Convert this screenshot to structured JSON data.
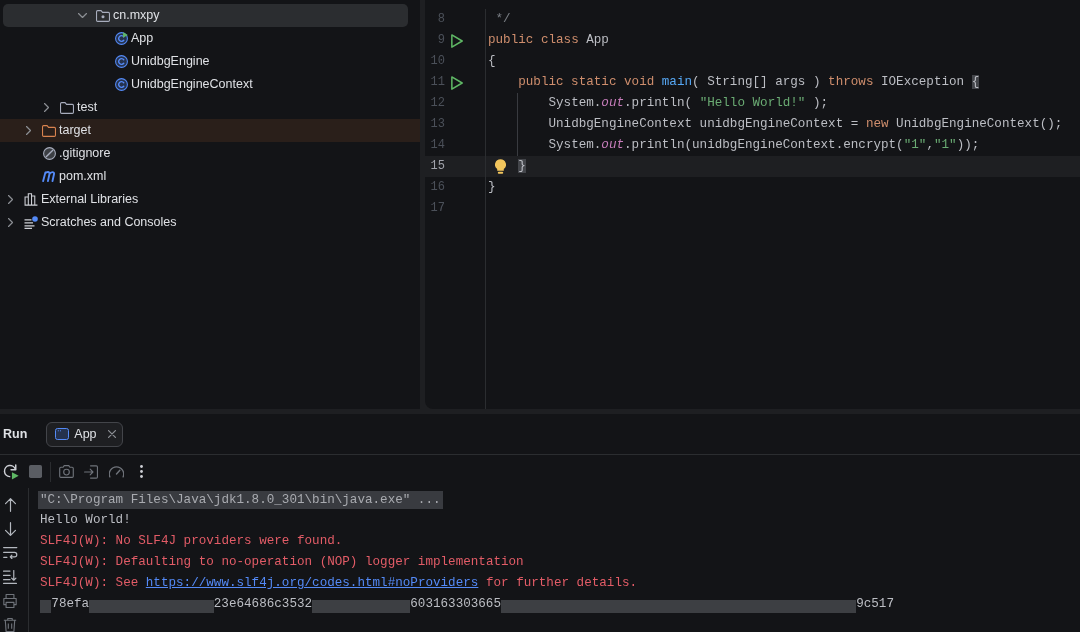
{
  "project_tree": {
    "items": [
      {
        "children": [
          {
            "children": [
              {
                "children": [
                  {
                    "children": [
                      {
                        "label": "cn.mxpy",
                        "kind": "package",
                        "expanded": true,
                        "selected": true,
                        "children": [
                          {
                            "label": "App",
                            "kind": "runnable-class",
                            "selected": false
                          },
                          {
                            "label": "UnidbgEngine",
                            "kind": "class",
                            "selected": false
                          },
                          {
                            "label": "UnidbgEngineContext",
                            "kind": "class",
                            "selected": false
                          }
                        ]
                      }
                    ]
                  }
                ]
              },
              {
                "label": "test",
                "kind": "folder",
                "expanded": false,
                "selected": false
              }
            ]
          },
          {
            "label": "target",
            "kind": "excluded-folder",
            "expanded": false,
            "selected": false
          },
          {
            "label": ".gitignore",
            "kind": "ignore-file",
            "selected": false
          },
          {
            "label": "pom.xml",
            "kind": "maven-file",
            "selected": false
          }
        ]
      },
      {
        "label": "External Libraries",
        "kind": "libraries",
        "expanded": false,
        "selected": false
      },
      {
        "label": "Scratches and Consoles",
        "kind": "scratches",
        "expanded": false,
        "selected": false
      }
    ]
  },
  "editor": {
    "lines": [
      {
        "number": "8",
        "kind": "comment",
        "current": false,
        "run": false,
        "bulb": false,
        "tokens": [
          {
            "kind": "comment",
            "text": "*/"
          }
        ]
      },
      {
        "number": "9",
        "kind": "top-level",
        "current": false,
        "run": true,
        "bulb": false,
        "tokens": [
          {
            "kind": "keyword",
            "text": "public class "
          },
          {
            "kind": "plain",
            "text": "App"
          }
        ]
      },
      {
        "number": "10",
        "kind": "top-level",
        "current": false,
        "run": false,
        "bulb": false,
        "tokens": [
          {
            "kind": "plain",
            "text": "{"
          }
        ]
      },
      {
        "number": "11",
        "kind": "class-body",
        "current": false,
        "run": true,
        "bulb": false,
        "tokens": [
          {
            "kind": "keyword",
            "text": "public static void "
          },
          {
            "kind": "method",
            "text": "main"
          },
          {
            "kind": "plain",
            "text": "( String[] args ) "
          },
          {
            "kind": "keyword",
            "text": "throws "
          },
          {
            "kind": "plain",
            "text": "IOException "
          },
          {
            "kind": "brace-match",
            "text": "{"
          }
        ]
      },
      {
        "number": "12",
        "kind": "method-body",
        "current": false,
        "run": false,
        "bulb": false,
        "tokens": [
          {
            "kind": "plain",
            "text": "System."
          },
          {
            "kind": "field",
            "text": "out"
          },
          {
            "kind": "plain",
            "text": ".println( "
          },
          {
            "kind": "string",
            "text": "\"Hello World!\""
          },
          {
            "kind": "plain",
            "text": " );"
          }
        ]
      },
      {
        "number": "13",
        "kind": "method-body",
        "current": false,
        "run": false,
        "bulb": false,
        "tokens": [
          {
            "kind": "plain",
            "text": "UnidbgEngineContext unidbgEngineContext = "
          },
          {
            "kind": "keyword",
            "text": "new "
          },
          {
            "kind": "plain",
            "text": "UnidbgEngineContext();"
          }
        ]
      },
      {
        "number": "14",
        "kind": "method-body",
        "current": false,
        "run": false,
        "bulb": false,
        "tokens": [
          {
            "kind": "plain",
            "text": "System."
          },
          {
            "kind": "field",
            "text": "out"
          },
          {
            "kind": "plain",
            "text": ".println(unidbgEngineContext.encrypt("
          },
          {
            "kind": "string",
            "text": "\"1\""
          },
          {
            "kind": "plain",
            "text": ","
          },
          {
            "kind": "string",
            "text": "\"1\""
          },
          {
            "kind": "plain",
            "text": "));"
          }
        ]
      },
      {
        "number": "15",
        "kind": "class-body",
        "current": true,
        "run": false,
        "bulb": true,
        "tokens": [
          {
            "kind": "brace-match",
            "text": "}"
          }
        ]
      },
      {
        "number": "16",
        "kind": "top-level",
        "current": false,
        "run": false,
        "bulb": false,
        "tokens": [
          {
            "kind": "plain",
            "text": "}"
          }
        ]
      },
      {
        "number": "17",
        "kind": "top-level",
        "current": false,
        "run": false,
        "bulb": false
      }
    ]
  },
  "run_panel": {
    "title": "Run",
    "tabs": [
      {
        "label": "App",
        "selected": true
      }
    ],
    "toolbar": [
      {
        "kind": "rerun",
        "disabled": false
      },
      {
        "kind": "stop",
        "disabled": true
      },
      {
        "kind": "screenshot",
        "disabled": true
      },
      {
        "kind": "attach",
        "disabled": true
      },
      {
        "kind": "profiler",
        "disabled": true
      },
      {
        "kind": "more",
        "disabled": false
      }
    ],
    "console": [
      {
        "kind": "command",
        "segments": [
          {
            "kind": "text",
            "text": "\"C:\\Program Files\\Java\\jdk1.8.0_301\\bin\\java.exe\" ..."
          }
        ]
      },
      {
        "kind": "stdout",
        "segments": [
          {
            "kind": "text",
            "text": "Hello World!"
          }
        ]
      },
      {
        "kind": "stderr",
        "segments": [
          {
            "kind": "text",
            "text": "SLF4J(W): No SLF4J providers were found."
          }
        ]
      },
      {
        "kind": "stderr",
        "segments": [
          {
            "kind": "text",
            "text": "SLF4J(W): Defaulting to no-operation (NOP) logger implementation"
          }
        ]
      },
      {
        "kind": "stderr",
        "segments": [
          {
            "kind": "text",
            "text": "SLF4J(W): See "
          },
          {
            "kind": "link",
            "text": "https://www.slf4j.org/codes.html#noProviders"
          },
          {
            "kind": "text",
            "text": " for further details."
          }
        ]
      },
      {
        "kind": "stdout",
        "segments": [
          {
            "kind": "redacted"
          },
          {
            "kind": "text",
            "text": "78efa"
          },
          {
            "kind": "redacted"
          },
          {
            "kind": "text",
            "text": "23e64686c3532"
          },
          {
            "kind": "redacted"
          },
          {
            "kind": "text",
            "text": "603163303665"
          },
          {
            "kind": "redacted"
          },
          {
            "kind": "text",
            "text": "9c517"
          }
        ]
      }
    ]
  }
}
